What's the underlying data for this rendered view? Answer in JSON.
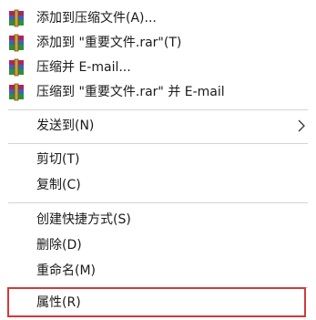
{
  "menu": {
    "items": [
      {
        "label": "添加到压缩文件(A)...",
        "icon": "winrar-archive-icon"
      },
      {
        "label": "添加到 \"重要文件.rar\"(T)",
        "icon": "winrar-archive-icon"
      },
      {
        "label": "压缩并 E-mail...",
        "icon": "winrar-archive-icon"
      },
      {
        "label": "压缩到 \"重要文件.rar\" 并 E-mail",
        "icon": "winrar-archive-icon"
      },
      {
        "label": "发送到(N)",
        "icon": "chevron-right-icon"
      },
      {
        "label": "剪切(T)"
      },
      {
        "label": "复制(C)"
      },
      {
        "label": "创建快捷方式(S)"
      },
      {
        "label": "删除(D)"
      },
      {
        "label": "重命名(M)"
      },
      {
        "label": "属性(R)"
      }
    ],
    "highlight_color": "#d33a3a",
    "separator_color": "#d4d4d4"
  }
}
